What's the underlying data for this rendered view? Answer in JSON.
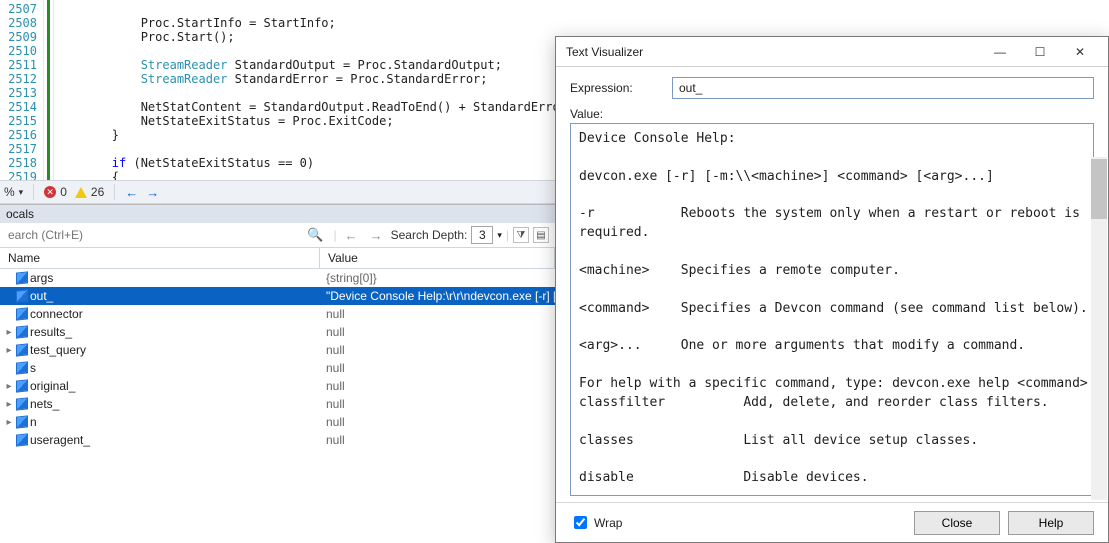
{
  "editor": {
    "line_start": 2507,
    "lines": [
      "",
      "            Proc.StartInfo = StartInfo;",
      "            Proc.Start();",
      "",
      "            StreamReader StandardOutput = Proc.StandardOutput;",
      "            StreamReader StandardError = Proc.StandardError;",
      "",
      "            NetStatContent = StandardOutput.ReadToEnd() + StandardError.ReadToEn",
      "            NetStateExitStatus = Proc.ExitCode;",
      "        }",
      "",
      "        if (NetStateExitStatus == 0)",
      "        {"
    ]
  },
  "statusbar": {
    "percent": "%",
    "errors": "0",
    "warnings": "26",
    "nav_back": "←",
    "nav_fwd": "→"
  },
  "locals": {
    "title": "ocals",
    "search_placeholder": "earch (Ctrl+E)",
    "depth_label": "Search Depth:",
    "depth_value": "3",
    "header_name": "Name",
    "header_value": "Value",
    "rows": [
      {
        "exp": "",
        "name": "args",
        "value": "{string[0]}"
      },
      {
        "exp": "",
        "name": "out_",
        "value": "\"Device Console Help:\\r\\r\\ndevcon.exe [-r] [-m",
        "selected": true
      },
      {
        "exp": "",
        "name": "connector",
        "value": "null"
      },
      {
        "exp": "▸",
        "name": "results_",
        "value": "null"
      },
      {
        "exp": "▸",
        "name": "test_query",
        "value": "null"
      },
      {
        "exp": "",
        "name": "s",
        "value": "null"
      },
      {
        "exp": "▸",
        "name": "original_",
        "value": "null"
      },
      {
        "exp": "▸",
        "name": "nets_",
        "value": "null"
      },
      {
        "exp": "▸",
        "name": "n",
        "value": "null"
      },
      {
        "exp": "",
        "name": "useragent_",
        "value": "null"
      }
    ]
  },
  "dialog": {
    "title": "Text Visualizer",
    "expression_label": "Expression:",
    "expression_value": "out_",
    "value_label": "Value:",
    "value_text": "Device Console Help:\n\ndevcon.exe [-r] [-m:\\\\<machine>] <command> [<arg>...]\n\n-r           Reboots the system only when a restart or reboot is\nrequired.\n\n<machine>    Specifies a remote computer.\n\n<command>    Specifies a Devcon command (see command list below).\n\n<arg>...     One or more arguments that modify a command.\n\nFor help with a specific command, type: devcon.exe help <command>\nclassfilter          Add, delete, and reorder class filters.\n\nclasses              List all device setup classes.\n\ndisable              Disable devices.\n\ndriverfiles          List installed driver files for devices.\n\ndrivernodes          List driver nodes of devices.\n\nenable               Enable devices.",
    "wrap_label": "Wrap",
    "wrap_checked": true,
    "close_label": "Close",
    "help_label": "Help"
  }
}
